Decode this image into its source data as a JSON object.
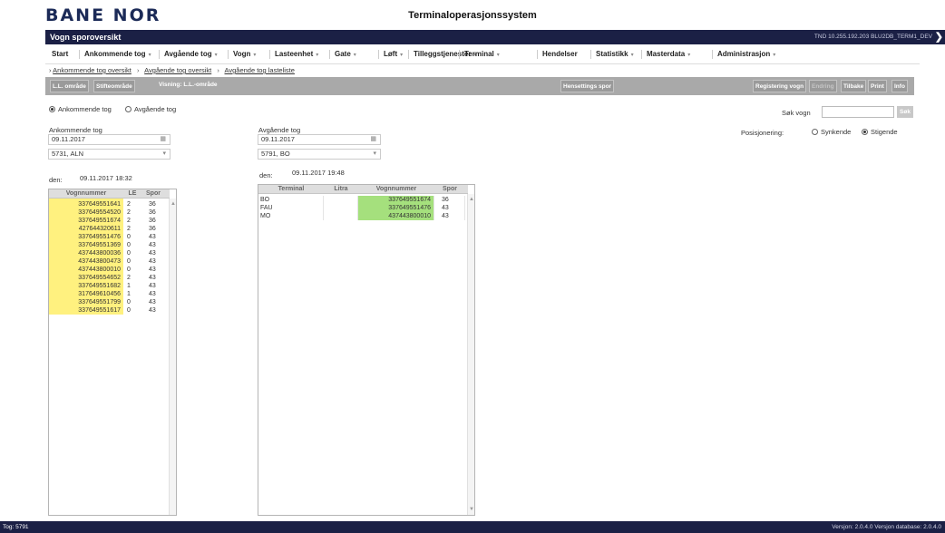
{
  "header": {
    "brand": "BANE NOR",
    "system_title": "Terminaloperasjonssystem"
  },
  "titlebar": {
    "title": "Vogn sporoversikt",
    "connection": "TND 10.255.192.203 BLU2DB_TERM1_DEV",
    "collapse_icon": "chevron-right-icon"
  },
  "menu": [
    {
      "label": "Start",
      "dropdown": false
    },
    {
      "label": "Ankommende tog",
      "dropdown": true
    },
    {
      "label": "Avgående tog",
      "dropdown": true
    },
    {
      "label": "Vogn",
      "dropdown": true
    },
    {
      "label": "Lasteenhet",
      "dropdown": true
    },
    {
      "label": "Gate",
      "dropdown": true
    },
    {
      "label": "Løft",
      "dropdown": true
    },
    {
      "label": "Tilleggstjenester",
      "dropdown": true
    },
    {
      "label": "Terminal",
      "dropdown": true
    },
    {
      "label": "Hendelser",
      "dropdown": false
    },
    {
      "label": "Statistikk",
      "dropdown": true
    },
    {
      "label": "Masterdata",
      "dropdown": true
    },
    {
      "label": "Administrasjon",
      "dropdown": true
    }
  ],
  "menu_caret": "▾",
  "breadcrumb": [
    "Ankommende tog oversikt",
    "Avgående tog oversikt",
    "Avgående tog lasteliste"
  ],
  "breadcrumb_sep": "›",
  "toolbar": {
    "ll_omrade": "L.L. område",
    "stifteomrade": "Stifteområde",
    "visning": "Visning: L.L.-område",
    "hensettings_spor": "Hensettings spor",
    "registrering_vogn": "Registering vogn",
    "endring": "Endring",
    "tilbake": "Tilbake",
    "print": "Print",
    "info": "Info"
  },
  "direction": {
    "ankommende": "Ankommende tog",
    "avgaende": "Avgående tog",
    "selected": "ankommende"
  },
  "search": {
    "label": "Søk vogn",
    "button": "Søk",
    "value": ""
  },
  "posisjonering": {
    "label": "Posisjonering:",
    "synkende": "Synkende",
    "stigende": "Stigende",
    "selected": "stigende"
  },
  "arrival": {
    "label": "Ankommende tog",
    "date": "09.11.2017",
    "train": "5731, ALN",
    "den_label": "den:",
    "den_value": "09.11.2017 18:32"
  },
  "departure": {
    "label": "Avgående tog",
    "date": "09.11.2017",
    "train": "5791, BO",
    "den_label": "den:",
    "den_value": "09.11.2017 19:48"
  },
  "calendar_icon": "▦",
  "select_caret": "▾",
  "arrival_table": {
    "headers": [
      "Vognnummer",
      "LE",
      "Spor"
    ],
    "rows": [
      [
        "337649551641",
        "2",
        "36"
      ],
      [
        "337649554520",
        "2",
        "36"
      ],
      [
        "337649551674",
        "2",
        "36"
      ],
      [
        "427644320611",
        "2",
        "36"
      ],
      [
        "337649551476",
        "0",
        "43"
      ],
      [
        "337649551369",
        "0",
        "43"
      ],
      [
        "437443800036",
        "0",
        "43"
      ],
      [
        "437443800473",
        "0",
        "43"
      ],
      [
        "437443800010",
        "0",
        "43"
      ],
      [
        "337649554652",
        "2",
        "43"
      ],
      [
        "337649551682",
        "1",
        "43"
      ],
      [
        "317649610456",
        "1",
        "43"
      ],
      [
        "337649551799",
        "0",
        "43"
      ],
      [
        "337649551617",
        "0",
        "43"
      ]
    ]
  },
  "departure_table": {
    "headers": [
      "Terminal",
      "Litra",
      "Vognnummer",
      "Spor"
    ],
    "rows": [
      [
        "BO",
        "",
        "337649551674",
        "36"
      ],
      [
        "FAU",
        "",
        "337649551476",
        "43"
      ],
      [
        "MO",
        "",
        "437443800010",
        "43"
      ]
    ]
  },
  "scroll": {
    "up": "▲",
    "down": "▼"
  },
  "status": {
    "left": "Tog: 5791",
    "right": "Versjon: 2.0.4.0 Versjon database: 2.0.4.0"
  },
  "colors": {
    "navy": "#1b2045",
    "toolbar_gray": "#a9a9a9",
    "row_yellow": "#fff17f",
    "row_green": "#a5e07d"
  }
}
